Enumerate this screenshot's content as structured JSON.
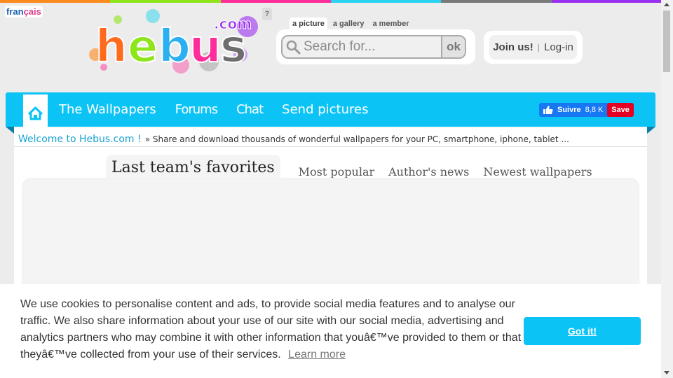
{
  "colors": {
    "accent": "#0bc4f5",
    "stripe": [
      "#ff8a1d",
      "#8ee51c",
      "#ff2d9b",
      "#2ad3f0",
      "#7a7a7a",
      "#9b2ff0"
    ],
    "facebook": "#1877f2",
    "pinterest": "#e60023"
  },
  "header": {
    "lang_part1": "fran",
    "lang_part2": "çais",
    "logo_text": "hebus",
    "logo_suffix": ".com",
    "help": "?",
    "search_tabs": [
      "a picture",
      "a gallery",
      "a member"
    ],
    "search_placeholder": "Search for...",
    "search_button": "ok",
    "join": "Join us!",
    "separator": "|",
    "login": "Log-in"
  },
  "nav": {
    "home_icon": "home-icon",
    "items": [
      "The Wallpapers",
      "Forums",
      "Chat",
      "Send pictures"
    ],
    "facebook_label": "Suivre",
    "facebook_count": "8,8 K",
    "pinterest_label": "Save"
  },
  "welcome": {
    "title": "Welcome to Hebus.com !",
    "text": "» Share and download thousands of wonderful wallpapers for your PC, smartphone, iphone, tablet ..."
  },
  "tabs": [
    "Last team's favorites",
    "Most popular",
    "Author's news",
    "Newest wallpapers"
  ],
  "cookie": {
    "message": "We use cookies to personalise content and ads, to provide social media features and to analyse our traffic. We also share information about your use of our site with our social media, advertising and analytics partners who may combine it with other information that youâ€™ve provided to them or that theyâ€™ve collected from your use of their services.",
    "learn_more": "Learn more",
    "button": "Got it!"
  }
}
